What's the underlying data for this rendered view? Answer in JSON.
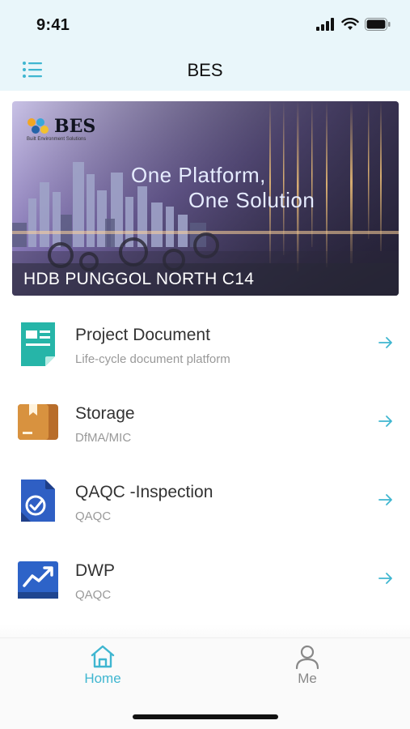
{
  "status_bar": {
    "time": "9:41"
  },
  "nav": {
    "title": "BES"
  },
  "banner": {
    "logo_text": "BES",
    "logo_subtext": "Built Environment Solutions",
    "slogan_line1": "One Platform,",
    "slogan_line2": "One Solution",
    "caption": "HDB PUNGGOL NORTH C14"
  },
  "modules": [
    {
      "title": "Project Document",
      "subtitle": "Life-cycle document platform",
      "icon": "document-icon",
      "color": "#26b5a8"
    },
    {
      "title": "Storage",
      "subtitle": "DfMA/MIC",
      "icon": "storage-box-icon",
      "color": "#c07a35"
    },
    {
      "title": "QAQC -Inspection",
      "subtitle": "QAQC",
      "icon": "inspection-check-icon",
      "color": "#2f5fc4"
    },
    {
      "title": "DWP",
      "subtitle": "QAQC",
      "icon": "trend-chart-icon",
      "color": "#2d63c8"
    }
  ],
  "tabs": {
    "home": {
      "label": "Home",
      "icon": "home-icon"
    },
    "me": {
      "label": "Me",
      "icon": "person-icon"
    }
  },
  "colors": {
    "accent": "#3fb6d0",
    "header_bg": "#e9f6fa"
  }
}
